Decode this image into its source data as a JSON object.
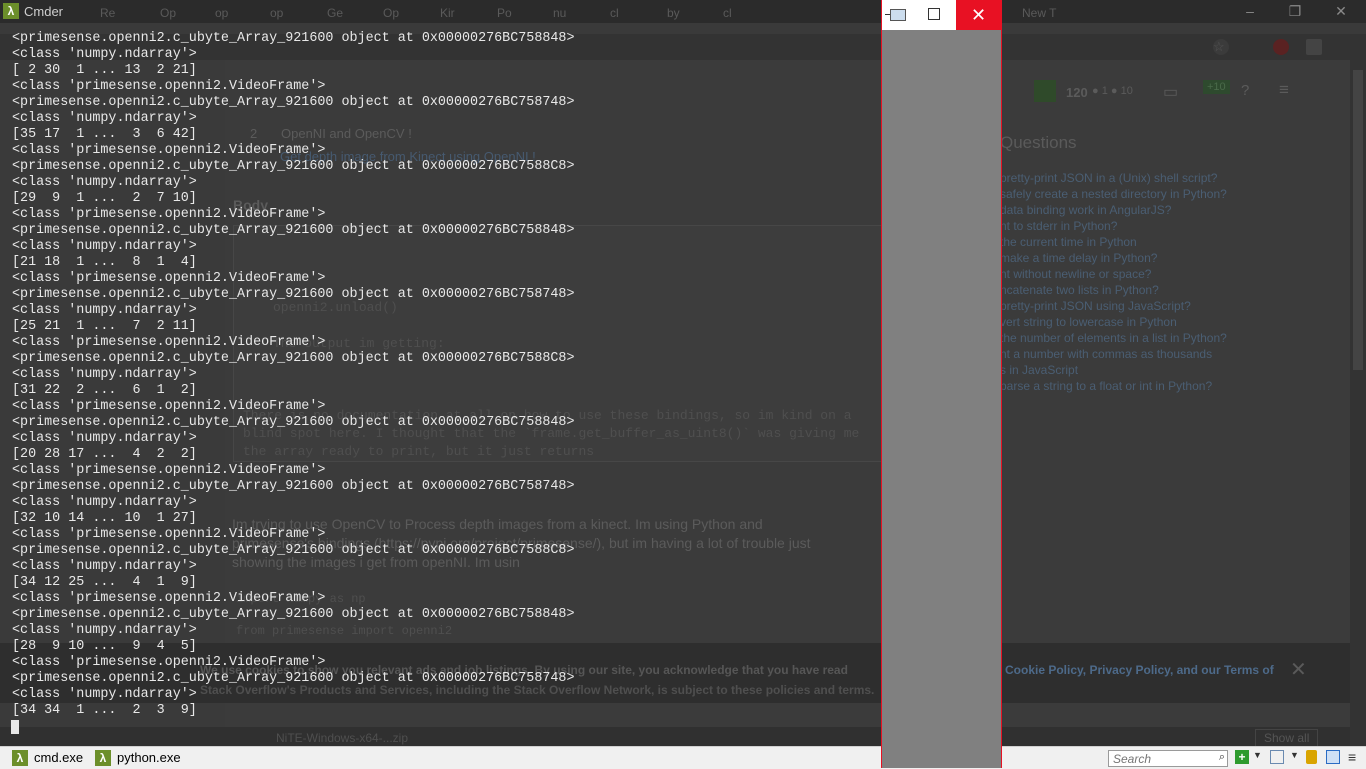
{
  "cmder": {
    "title": "Cmder",
    "console_lines": [
      "<primesense.openni2.c_ubyte_Array_921600 object at 0x00000276BC758848>",
      "<class 'numpy.ndarray'>",
      "[ 2 30  1 ... 13  2 21]",
      "<class 'primesense.openni2.VideoFrame'>",
      "<primesense.openni2.c_ubyte_Array_921600 object at 0x00000276BC758748>",
      "<class 'numpy.ndarray'>",
      "[35 17  1 ...  3  6 42]",
      "<class 'primesense.openni2.VideoFrame'>",
      "<primesense.openni2.c_ubyte_Array_921600 object at 0x00000276BC7588C8>",
      "<class 'numpy.ndarray'>",
      "[29  9  1 ...  2  7 10]",
      "<class 'primesense.openni2.VideoFrame'>",
      "<primesense.openni2.c_ubyte_Array_921600 object at 0x00000276BC758848>",
      "<class 'numpy.ndarray'>",
      "[21 18  1 ...  8  1  4]",
      "<class 'primesense.openni2.VideoFrame'>",
      "<primesense.openni2.c_ubyte_Array_921600 object at 0x00000276BC758748>",
      "<class 'numpy.ndarray'>",
      "[25 21  1 ...  7  2 11]",
      "<class 'primesense.openni2.VideoFrame'>",
      "<primesense.openni2.c_ubyte_Array_921600 object at 0x00000276BC7588C8>",
      "<class 'numpy.ndarray'>",
      "[31 22  2 ...  6  1  2]",
      "<class 'primesense.openni2.VideoFrame'>",
      "<primesense.openni2.c_ubyte_Array_921600 object at 0x00000276BC758848>",
      "<class 'numpy.ndarray'>",
      "[20 28 17 ...  4  2  2]",
      "<class 'primesense.openni2.VideoFrame'>",
      "<primesense.openni2.c_ubyte_Array_921600 object at 0x00000276BC758748>",
      "<class 'numpy.ndarray'>",
      "[32 10 14 ... 10  1 27]",
      "<class 'primesense.openni2.VideoFrame'>",
      "<primesense.openni2.c_ubyte_Array_921600 object at 0x00000276BC7588C8>",
      "<class 'numpy.ndarray'>",
      "[34 12 25 ...  4  1  9]",
      "<class 'primesense.openni2.VideoFrame'>",
      "<primesense.openni2.c_ubyte_Array_921600 object at 0x00000276BC758848>",
      "<class 'numpy.ndarray'>",
      "[28  9 10 ...  9  4  5]",
      "<class 'primesense.openni2.VideoFrame'>",
      "<primesense.openni2.c_ubyte_Array_921600 object at 0x00000276BC758748>",
      "<class 'numpy.ndarray'>",
      "[34 34  1 ...  2  3  9]"
    ],
    "tabs": [
      {
        "label": "cmd.exe"
      },
      {
        "label": "python.exe"
      }
    ],
    "search_placeholder": "Search",
    "logo_glyph": "λ"
  },
  "cv_window": {
    "close_glyph": "✕"
  },
  "browser": {
    "tabs": [
      "Re",
      "Op",
      "op",
      "op",
      "Ge",
      "Op",
      "Kir",
      "Po",
      "nu",
      "cl",
      "by",
      "cl",
      "New T"
    ],
    "rep": "120",
    "rep_badges": "● 1 ● 10",
    "editor": {
      "title_line": "OpenNI and OpenCV !",
      "subtitle_line": "Get depth image from Kinect using OpenNI !",
      "body_label": "Body",
      "code_lines": [
        "openni2.unload()"
      ],
      "text_lines": [
        "The output im getting:",
        "There is no documentation at all on how to use these bindings, so im kind on a",
        "blind spot here. I thought that the `frame.get_buffer_as_uint8()` was giving me",
        "the array ready to print, but it just returns"
      ]
    },
    "question_lines": [
      "Im trying to use OpenCV to Process depth images from a kinect. Im using Python and",
      "primesense's bindings (https://pypi.org/project/primesense/), but im having a lot of trouble just",
      "showing the images i get from openNI. Im usin"
    ],
    "code_preview": [
      "import numpy as np",
      "from primesense import openni2"
    ],
    "related": {
      "title": "Questions",
      "items": [
        "pretty-print JSON in a (Unix) shell script?",
        "safely create a nested directory in Python?",
        "data binding work in AngularJS?",
        "nt to stderr in Python?",
        "the current time in Python",
        "make a time delay in Python?",
        "nt without newline or space?",
        "ncatenate two lists in Python?",
        "pretty-print JSON using JavaScript?",
        "vert string to lowercase in Python",
        "the number of elements in a list in Python?",
        "nt a number with commas as thousands",
        "s in JavaScript",
        "parse a string to a float or int in Python?"
      ]
    },
    "cookie": {
      "line1": "We use cookies to show you relevant ads and job listings. By using our site, you acknowledge that you have read",
      "links": "Cookie Policy, Privacy Policy, and our Terms of",
      "line2": "Stack Overflow's Products and Services, including the Stack Overflow Network, is subject to these policies and terms.",
      "close": "✕"
    },
    "download": {
      "file": "NiTE-Windows-x64-...zip",
      "show_all": "Show all"
    }
  }
}
